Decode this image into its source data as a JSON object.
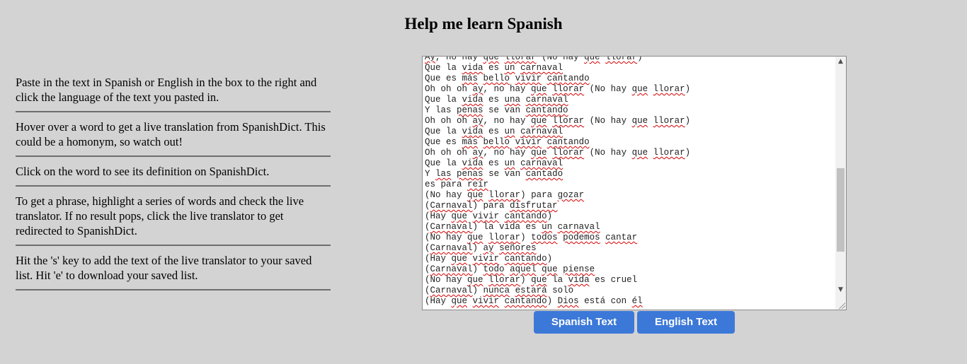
{
  "page": {
    "title": "Help me learn Spanish",
    "background_color": "#d3d3d3"
  },
  "instructions": [
    "Paste in the text in Spanish or English in the box to the right and click the language of the text you pasted in.",
    "Hover over a word to get a live translation from SpanishDict. This could be a homonym, so watch out!",
    "Click on the word to see its definition on SpanishDict.",
    "To get a phrase, highlight a series of words and check the live translator. If no result pops, click the live translator to get redirected to SpanishDict.",
    "Hit the 's' key to add the text of the live translator to your saved list. Hit 'e' to download your saved list."
  ],
  "textarea": {
    "lines": [
      [
        {
          "t": "Ay",
          "w": true
        },
        {
          "t": ", no hay "
        },
        {
          "t": "que",
          "w": true
        },
        {
          "t": " "
        },
        {
          "t": "llorar",
          "w": true
        },
        {
          "t": " (No hay "
        },
        {
          "t": "que",
          "w": true
        },
        {
          "t": " "
        },
        {
          "t": "llorar",
          "w": true
        },
        {
          "t": ")"
        }
      ],
      [
        {
          "t": "Que la "
        },
        {
          "t": "vida",
          "w": true
        },
        {
          "t": " es "
        },
        {
          "t": "un",
          "w": true
        },
        {
          "t": " "
        },
        {
          "t": "carnaval",
          "w": true
        }
      ],
      [
        {
          "t": "Que es "
        },
        {
          "t": "más",
          "w": true
        },
        {
          "t": " "
        },
        {
          "t": "bello",
          "w": true
        },
        {
          "t": " "
        },
        {
          "t": "vivir",
          "w": true
        },
        {
          "t": " "
        },
        {
          "t": "cantando",
          "w": true
        }
      ],
      [
        {
          "t": "Oh oh oh "
        },
        {
          "t": "ay",
          "w": true
        },
        {
          "t": ", no hay "
        },
        {
          "t": "que",
          "w": true
        },
        {
          "t": " "
        },
        {
          "t": "llorar",
          "w": true
        },
        {
          "t": " (No hay "
        },
        {
          "t": "que",
          "w": true
        },
        {
          "t": " "
        },
        {
          "t": "llorar",
          "w": true
        },
        {
          "t": ")"
        }
      ],
      [
        {
          "t": "Que la "
        },
        {
          "t": "vida",
          "w": true
        },
        {
          "t": " es "
        },
        {
          "t": "una",
          "w": true
        },
        {
          "t": " "
        },
        {
          "t": "carnaval",
          "w": true
        }
      ],
      [
        {
          "t": "Y las "
        },
        {
          "t": "penas",
          "w": true
        },
        {
          "t": " se van "
        },
        {
          "t": "cantando",
          "w": true
        }
      ],
      [
        {
          "t": "Oh oh oh "
        },
        {
          "t": "ay",
          "w": true
        },
        {
          "t": ", no hay "
        },
        {
          "t": "que",
          "w": true
        },
        {
          "t": " "
        },
        {
          "t": "llorar",
          "w": true
        },
        {
          "t": " (No hay "
        },
        {
          "t": "que",
          "w": true
        },
        {
          "t": " "
        },
        {
          "t": "llorar",
          "w": true
        },
        {
          "t": ")"
        }
      ],
      [
        {
          "t": "Que la "
        },
        {
          "t": "vida",
          "w": true
        },
        {
          "t": " es "
        },
        {
          "t": "un",
          "w": true
        },
        {
          "t": " "
        },
        {
          "t": "carnaval",
          "w": true
        }
      ],
      [
        {
          "t": "Que es "
        },
        {
          "t": "más",
          "w": true
        },
        {
          "t": " "
        },
        {
          "t": "bello",
          "w": true
        },
        {
          "t": " "
        },
        {
          "t": "vivir",
          "w": true
        },
        {
          "t": " "
        },
        {
          "t": "cantando",
          "w": true
        }
      ],
      [
        {
          "t": "Oh oh oh "
        },
        {
          "t": "ay",
          "w": true
        },
        {
          "t": ", no hay "
        },
        {
          "t": "que",
          "w": true
        },
        {
          "t": " "
        },
        {
          "t": "llorar",
          "w": true
        },
        {
          "t": " (No hay "
        },
        {
          "t": "que",
          "w": true
        },
        {
          "t": " "
        },
        {
          "t": "llorar",
          "w": true
        },
        {
          "t": ")"
        }
      ],
      [
        {
          "t": "Que la "
        },
        {
          "t": "vida",
          "w": true
        },
        {
          "t": " es "
        },
        {
          "t": "un",
          "w": true
        },
        {
          "t": " "
        },
        {
          "t": "carnaval",
          "w": true
        }
      ],
      [
        {
          "t": "Y "
        },
        {
          "t": "las",
          "w": true
        },
        {
          "t": " "
        },
        {
          "t": "penas",
          "w": true
        },
        {
          "t": " se van "
        },
        {
          "t": "cantado",
          "w": true
        }
      ],
      [
        {
          "t": "es para "
        },
        {
          "t": "reír",
          "w": true
        }
      ],
      [
        {
          "t": "(No hay "
        },
        {
          "t": "que",
          "w": true
        },
        {
          "t": " "
        },
        {
          "t": "llorar",
          "w": true
        },
        {
          "t": ") para "
        },
        {
          "t": "gozar",
          "w": true
        }
      ],
      [
        {
          "t": "("
        },
        {
          "t": "Carnaval",
          "w": true
        },
        {
          "t": ") para "
        },
        {
          "t": "disfrutar",
          "w": true
        }
      ],
      [
        {
          "t": "(Hay "
        },
        {
          "t": "que",
          "w": true
        },
        {
          "t": " "
        },
        {
          "t": "vivir",
          "w": true
        },
        {
          "t": " "
        },
        {
          "t": "cantando",
          "w": true
        },
        {
          "t": ")"
        }
      ],
      [
        {
          "t": "("
        },
        {
          "t": "Carnaval",
          "w": true
        },
        {
          "t": ") la vida es "
        },
        {
          "t": "un",
          "w": true
        },
        {
          "t": " "
        },
        {
          "t": "carnaval",
          "w": true
        }
      ],
      [
        {
          "t": "(No hay "
        },
        {
          "t": "que",
          "w": true
        },
        {
          "t": " "
        },
        {
          "t": "llorar",
          "w": true
        },
        {
          "t": ") "
        },
        {
          "t": "todos",
          "w": true
        },
        {
          "t": " "
        },
        {
          "t": "podemos",
          "w": true
        },
        {
          "t": " "
        },
        {
          "t": "cantar",
          "w": true
        }
      ],
      [
        {
          "t": "("
        },
        {
          "t": "Carnaval",
          "w": true
        },
        {
          "t": ") "
        },
        {
          "t": "ay",
          "w": true
        },
        {
          "t": " "
        },
        {
          "t": "señores",
          "w": true
        }
      ],
      [
        {
          "t": "(Hay "
        },
        {
          "t": "que",
          "w": true
        },
        {
          "t": " "
        },
        {
          "t": "vivir",
          "w": true
        },
        {
          "t": " "
        },
        {
          "t": "cantando",
          "w": true
        },
        {
          "t": ")"
        }
      ],
      [
        {
          "t": "("
        },
        {
          "t": "Carnaval",
          "w": true
        },
        {
          "t": ") "
        },
        {
          "t": "todo",
          "w": true
        },
        {
          "t": " "
        },
        {
          "t": "aquel",
          "w": true
        },
        {
          "t": " "
        },
        {
          "t": "que",
          "w": true
        },
        {
          "t": " "
        },
        {
          "t": "piense",
          "w": true
        }
      ],
      [
        {
          "t": "(No hay "
        },
        {
          "t": "que",
          "w": true
        },
        {
          "t": " "
        },
        {
          "t": "llorar",
          "w": true
        },
        {
          "t": ") "
        },
        {
          "t": "que",
          "w": true
        },
        {
          "t": " la "
        },
        {
          "t": "vida",
          "w": true
        },
        {
          "t": " es cruel"
        }
      ],
      [
        {
          "t": "("
        },
        {
          "t": "Carnaval",
          "w": true
        },
        {
          "t": ") "
        },
        {
          "t": "nunca",
          "w": true
        },
        {
          "t": " "
        },
        {
          "t": "estará",
          "w": true
        },
        {
          "t": " solo"
        }
      ],
      [
        {
          "t": "(Hay "
        },
        {
          "t": "que",
          "w": true
        },
        {
          "t": " "
        },
        {
          "t": "vivir",
          "w": true
        },
        {
          "t": " "
        },
        {
          "t": "cantando",
          "w": true
        },
        {
          "t": ") "
        },
        {
          "t": "Dios",
          "w": true
        },
        {
          "t": " está con "
        },
        {
          "t": "él",
          "w": true
        }
      ]
    ],
    "scroll_position": 0.75,
    "spellcheck_color": "#d60000"
  },
  "buttons": {
    "spanish_label": "Spanish Text",
    "english_label": "English Text",
    "color": "#3c78d8"
  },
  "icons": {
    "scroll_up": "▲",
    "scroll_down": "▼"
  }
}
